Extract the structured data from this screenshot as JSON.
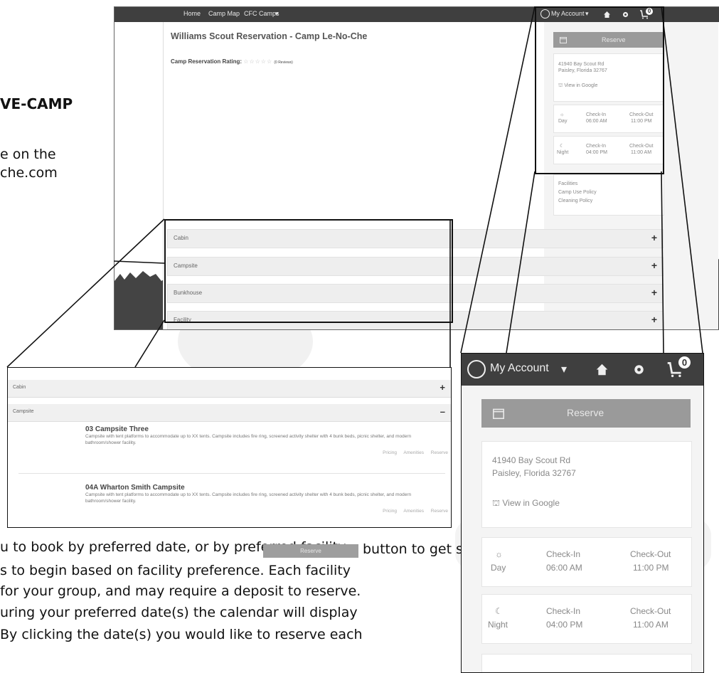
{
  "document": {
    "heading_fragment": "VE-CAMP",
    "intro_line1": "e on the",
    "intro_line2": "che.com",
    "para_line1": "u to book by preferred date, or by preferred facility,",
    "para_line2_pre": "",
    "para_line2_post": "button to get started by date; choose the",
    "para_line3": "s to begin based on facility preference.  Each facility",
    "para_line4": "for your group, and may require a deposit to reserve.",
    "para_line5": "uring your preferred date(s) the calendar will display",
    "para_line6": "By clicking the date(s) you would like to reserve each",
    "inline_button_label": "Reserve"
  },
  "screenshot": {
    "nav": {
      "home": "Home",
      "camp_map": "Camp Map",
      "cfc_camps": "CFC Camps",
      "cfc_caret": "▾"
    },
    "account": {
      "label": "My Account",
      "caret": "▾",
      "cart_count": "0"
    },
    "page_title": "Williams Scout Reservation - Camp Le-No-Che",
    "rating_label": "Camp Reservation Rating:",
    "rating_stars": "☆☆☆☆☆",
    "rating_reviews": "(0 Reviews)",
    "sidebar": {
      "reserve_label": "Reserve",
      "address_line1": "41940 Bay Scout Rd",
      "address_line2": "Paisley, Florida 32767",
      "map_link": "View in Google",
      "day_label": "Day",
      "day_icon": "☼",
      "night_label": "Night",
      "night_icon": "☾",
      "checkin_label": "Check-In",
      "checkout_label": "Check-Out",
      "day_checkin_time": "06:00 AM",
      "day_checkout_time": "11:00 PM",
      "night_checkin_time": "04:00 PM",
      "night_checkout_time": "11:00 AM",
      "links": [
        "Facilities",
        "Camp Use Policy",
        "Cleaning Policy"
      ]
    },
    "accordion": [
      {
        "label": "Cabin",
        "sign": "+"
      },
      {
        "label": "Campsite",
        "sign": "+"
      },
      {
        "label": "Bunkhouse",
        "sign": "+"
      },
      {
        "label": "Facility",
        "sign": "+"
      }
    ]
  },
  "zoom_left": {
    "cabin": {
      "label": "Cabin",
      "sign": "+"
    },
    "campsite": {
      "label": "Campsite",
      "sign": "–"
    },
    "sites": [
      {
        "title": "03 Campsite Three",
        "description": "Campsite with tent platforms to accommodate up to XX tents. Campsite includes fire ring, screened activity shelter with 4 bunk beds, picnic shelter, and modern bathroom/shower facility.",
        "links": [
          "Pricing",
          "Amenities",
          "Reserve"
        ]
      },
      {
        "title": "04A Wharton Smith Campsite",
        "description": "Campsite with tent platforms to accommodate up to XX tents. Campsite includes fire ring, screened activity shelter with 4 bunk beds, picnic shelter, and modern bathroom/shower facility.",
        "links": [
          "Pricing",
          "Amenities",
          "Reserve"
        ]
      }
    ]
  },
  "zoom_right": {
    "account_label": "My Account",
    "account_caret": "▾",
    "cart_count": "0",
    "reserve_label": "Reserve",
    "address_line1": "41940 Bay Scout Rd",
    "address_line2": "Paisley, Florida 32767",
    "map_link": "View in Google",
    "day_label": "Day",
    "day_icon": "☼",
    "night_label": "Night",
    "night_icon": "☾",
    "checkin_label": "Check-In",
    "checkout_label": "Check-Out",
    "day_checkin_time": "06:00 AM",
    "day_checkout_time": "11:00 PM",
    "night_checkin_time": "04:00 PM",
    "night_checkout_time": "11:00 AM"
  },
  "colors": {
    "topbar": "#3f3f3f",
    "reserve_button": "#9a9a9a",
    "accordion": "#eeeeee",
    "sidebar_bg": "#f4f4f4"
  }
}
